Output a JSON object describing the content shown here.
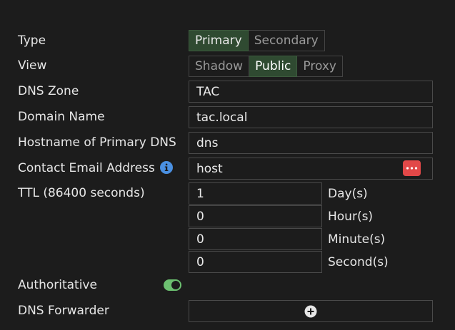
{
  "type": {
    "label": "Type",
    "options": [
      "Primary",
      "Secondary"
    ],
    "selected": "Primary"
  },
  "view": {
    "label": "View",
    "options": [
      "Shadow",
      "Public",
      "Proxy"
    ],
    "selected": "Public"
  },
  "dns_zone": {
    "label": "DNS Zone",
    "value": "TAC"
  },
  "domain_name": {
    "label": "Domain Name",
    "value": "tac.local"
  },
  "primary_dns": {
    "label": "Hostname of Primary DNS",
    "value": "dns"
  },
  "contact_email": {
    "label": "Contact Email Address",
    "value": "host"
  },
  "ttl": {
    "label": "TTL (86400 seconds)",
    "days": "1",
    "days_unit": "Day(s)",
    "hours": "0",
    "hours_unit": "Hour(s)",
    "minutes": "0",
    "minutes_unit": "Minute(s)",
    "seconds": "0",
    "seconds_unit": "Second(s)"
  },
  "authoritative": {
    "label": "Authoritative",
    "enabled": true
  },
  "dns_forwarder": {
    "label": "DNS Forwarder"
  },
  "colors": {
    "background": "#1c1c1c",
    "active_segment": "#2f4a31",
    "toggle_on": "#6cc070",
    "info": "#4a90e2",
    "password_button": "#e24848"
  }
}
